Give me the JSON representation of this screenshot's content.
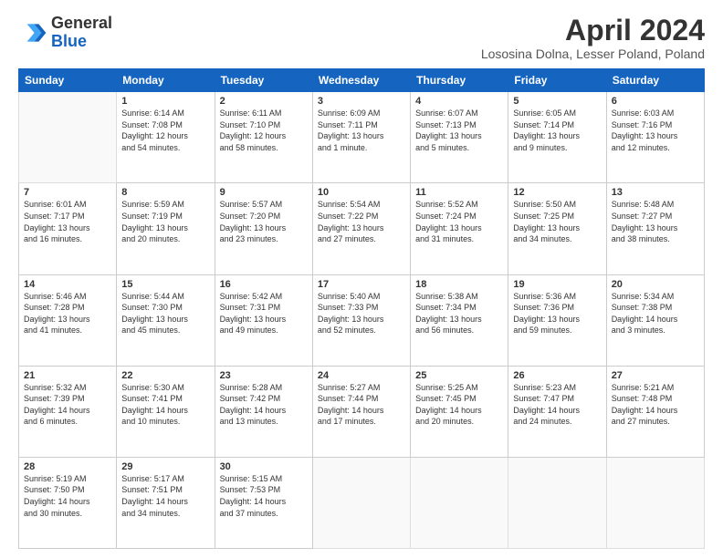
{
  "logo": {
    "general": "General",
    "blue": "Blue"
  },
  "title": "April 2024",
  "location": "Lososina Dolna, Lesser Poland, Poland",
  "days": [
    "Sunday",
    "Monday",
    "Tuesday",
    "Wednesday",
    "Thursday",
    "Friday",
    "Saturday"
  ],
  "weeks": [
    [
      {
        "day": "",
        "content": ""
      },
      {
        "day": "1",
        "content": "Sunrise: 6:14 AM\nSunset: 7:08 PM\nDaylight: 12 hours\nand 54 minutes."
      },
      {
        "day": "2",
        "content": "Sunrise: 6:11 AM\nSunset: 7:10 PM\nDaylight: 12 hours\nand 58 minutes."
      },
      {
        "day": "3",
        "content": "Sunrise: 6:09 AM\nSunset: 7:11 PM\nDaylight: 13 hours\nand 1 minute."
      },
      {
        "day": "4",
        "content": "Sunrise: 6:07 AM\nSunset: 7:13 PM\nDaylight: 13 hours\nand 5 minutes."
      },
      {
        "day": "5",
        "content": "Sunrise: 6:05 AM\nSunset: 7:14 PM\nDaylight: 13 hours\nand 9 minutes."
      },
      {
        "day": "6",
        "content": "Sunrise: 6:03 AM\nSunset: 7:16 PM\nDaylight: 13 hours\nand 12 minutes."
      }
    ],
    [
      {
        "day": "7",
        "content": "Sunrise: 6:01 AM\nSunset: 7:17 PM\nDaylight: 13 hours\nand 16 minutes."
      },
      {
        "day": "8",
        "content": "Sunrise: 5:59 AM\nSunset: 7:19 PM\nDaylight: 13 hours\nand 20 minutes."
      },
      {
        "day": "9",
        "content": "Sunrise: 5:57 AM\nSunset: 7:20 PM\nDaylight: 13 hours\nand 23 minutes."
      },
      {
        "day": "10",
        "content": "Sunrise: 5:54 AM\nSunset: 7:22 PM\nDaylight: 13 hours\nand 27 minutes."
      },
      {
        "day": "11",
        "content": "Sunrise: 5:52 AM\nSunset: 7:24 PM\nDaylight: 13 hours\nand 31 minutes."
      },
      {
        "day": "12",
        "content": "Sunrise: 5:50 AM\nSunset: 7:25 PM\nDaylight: 13 hours\nand 34 minutes."
      },
      {
        "day": "13",
        "content": "Sunrise: 5:48 AM\nSunset: 7:27 PM\nDaylight: 13 hours\nand 38 minutes."
      }
    ],
    [
      {
        "day": "14",
        "content": "Sunrise: 5:46 AM\nSunset: 7:28 PM\nDaylight: 13 hours\nand 41 minutes."
      },
      {
        "day": "15",
        "content": "Sunrise: 5:44 AM\nSunset: 7:30 PM\nDaylight: 13 hours\nand 45 minutes."
      },
      {
        "day": "16",
        "content": "Sunrise: 5:42 AM\nSunset: 7:31 PM\nDaylight: 13 hours\nand 49 minutes."
      },
      {
        "day": "17",
        "content": "Sunrise: 5:40 AM\nSunset: 7:33 PM\nDaylight: 13 hours\nand 52 minutes."
      },
      {
        "day": "18",
        "content": "Sunrise: 5:38 AM\nSunset: 7:34 PM\nDaylight: 13 hours\nand 56 minutes."
      },
      {
        "day": "19",
        "content": "Sunrise: 5:36 AM\nSunset: 7:36 PM\nDaylight: 13 hours\nand 59 minutes."
      },
      {
        "day": "20",
        "content": "Sunrise: 5:34 AM\nSunset: 7:38 PM\nDaylight: 14 hours\nand 3 minutes."
      }
    ],
    [
      {
        "day": "21",
        "content": "Sunrise: 5:32 AM\nSunset: 7:39 PM\nDaylight: 14 hours\nand 6 minutes."
      },
      {
        "day": "22",
        "content": "Sunrise: 5:30 AM\nSunset: 7:41 PM\nDaylight: 14 hours\nand 10 minutes."
      },
      {
        "day": "23",
        "content": "Sunrise: 5:28 AM\nSunset: 7:42 PM\nDaylight: 14 hours\nand 13 minutes."
      },
      {
        "day": "24",
        "content": "Sunrise: 5:27 AM\nSunset: 7:44 PM\nDaylight: 14 hours\nand 17 minutes."
      },
      {
        "day": "25",
        "content": "Sunrise: 5:25 AM\nSunset: 7:45 PM\nDaylight: 14 hours\nand 20 minutes."
      },
      {
        "day": "26",
        "content": "Sunrise: 5:23 AM\nSunset: 7:47 PM\nDaylight: 14 hours\nand 24 minutes."
      },
      {
        "day": "27",
        "content": "Sunrise: 5:21 AM\nSunset: 7:48 PM\nDaylight: 14 hours\nand 27 minutes."
      }
    ],
    [
      {
        "day": "28",
        "content": "Sunrise: 5:19 AM\nSunset: 7:50 PM\nDaylight: 14 hours\nand 30 minutes."
      },
      {
        "day": "29",
        "content": "Sunrise: 5:17 AM\nSunset: 7:51 PM\nDaylight: 14 hours\nand 34 minutes."
      },
      {
        "day": "30",
        "content": "Sunrise: 5:15 AM\nSunset: 7:53 PM\nDaylight: 14 hours\nand 37 minutes."
      },
      {
        "day": "",
        "content": ""
      },
      {
        "day": "",
        "content": ""
      },
      {
        "day": "",
        "content": ""
      },
      {
        "day": "",
        "content": ""
      }
    ]
  ]
}
